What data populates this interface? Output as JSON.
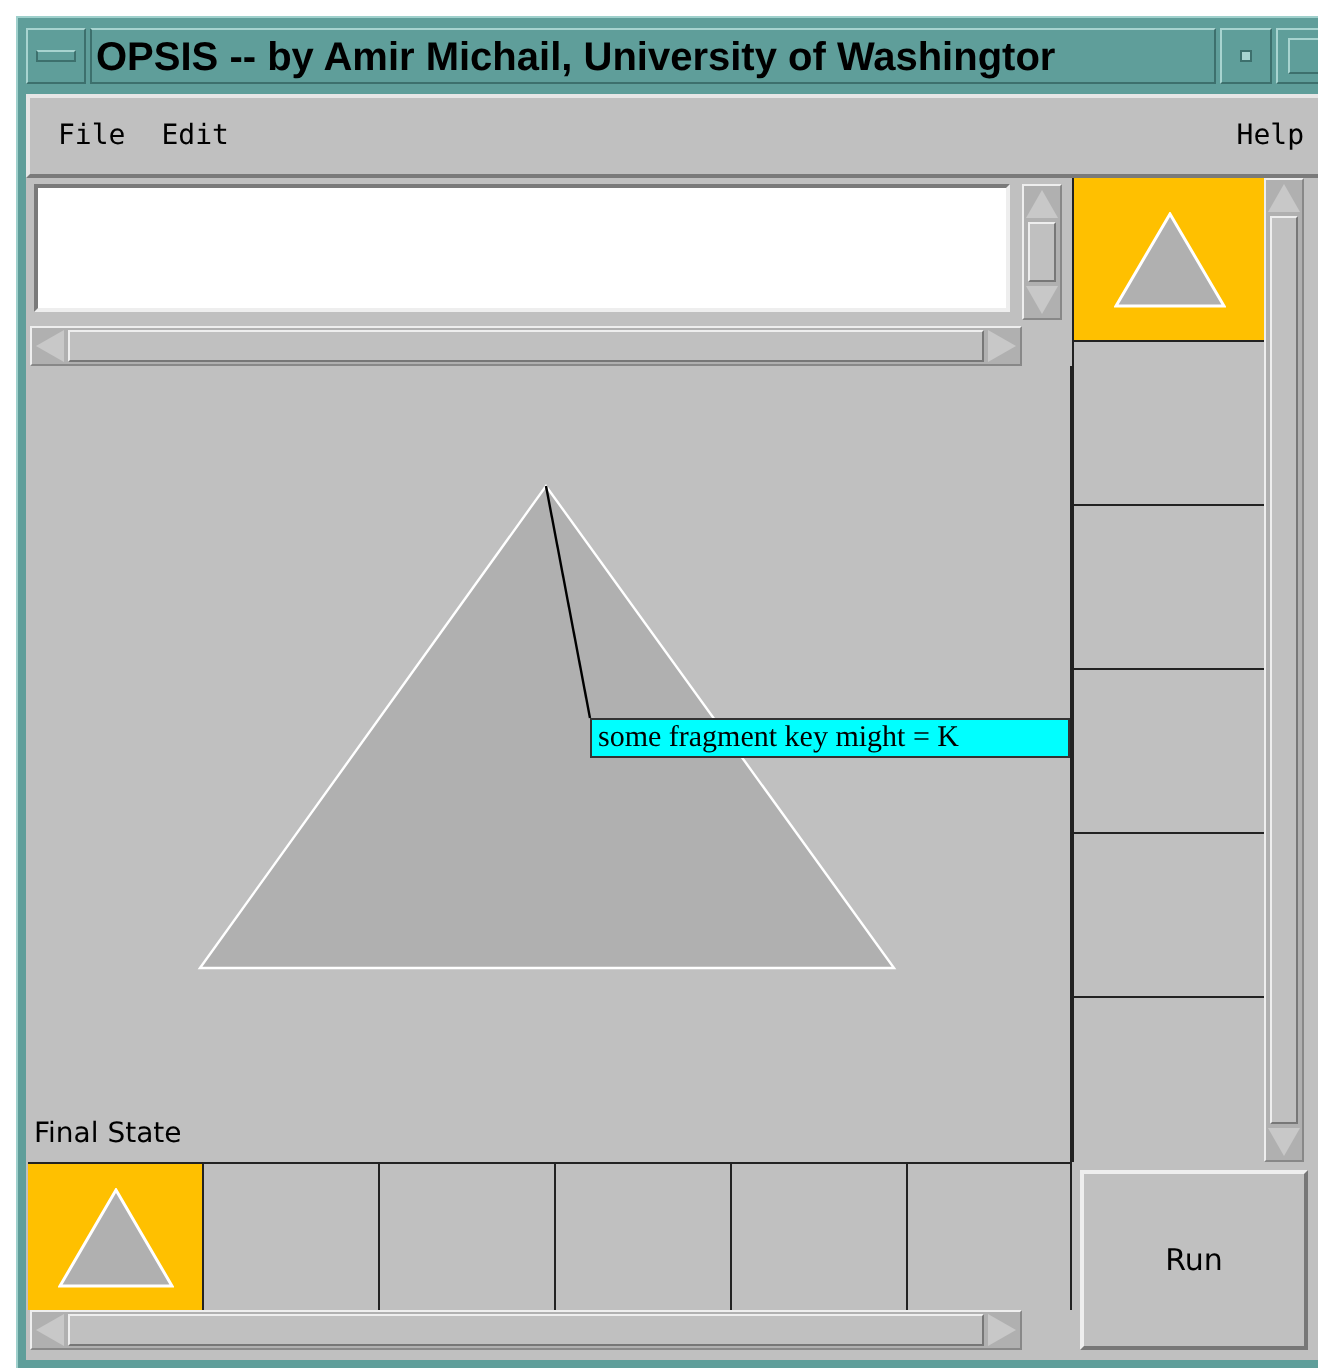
{
  "window": {
    "title": "OPSIS -- by Amir Michail, University of Washingtor"
  },
  "menu": {
    "left": [
      "File",
      "Edit"
    ],
    "right": "Help"
  },
  "canvas": {
    "tooltip": "some fragment key might = K",
    "caption": "Final State"
  },
  "side_frames": [
    {
      "kind": "triangle",
      "selected": true
    },
    {
      "kind": "empty",
      "selected": false
    },
    {
      "kind": "empty",
      "selected": false
    },
    {
      "kind": "empty",
      "selected": false
    },
    {
      "kind": "empty",
      "selected": false
    },
    {
      "kind": "empty",
      "selected": false
    }
  ],
  "bottom_frames": [
    {
      "kind": "triangle",
      "selected": true
    },
    {
      "kind": "empty",
      "selected": false
    },
    {
      "kind": "empty",
      "selected": false
    },
    {
      "kind": "empty",
      "selected": false
    },
    {
      "kind": "empty",
      "selected": false
    },
    {
      "kind": "empty",
      "selected": false
    }
  ],
  "run_button": "Run"
}
